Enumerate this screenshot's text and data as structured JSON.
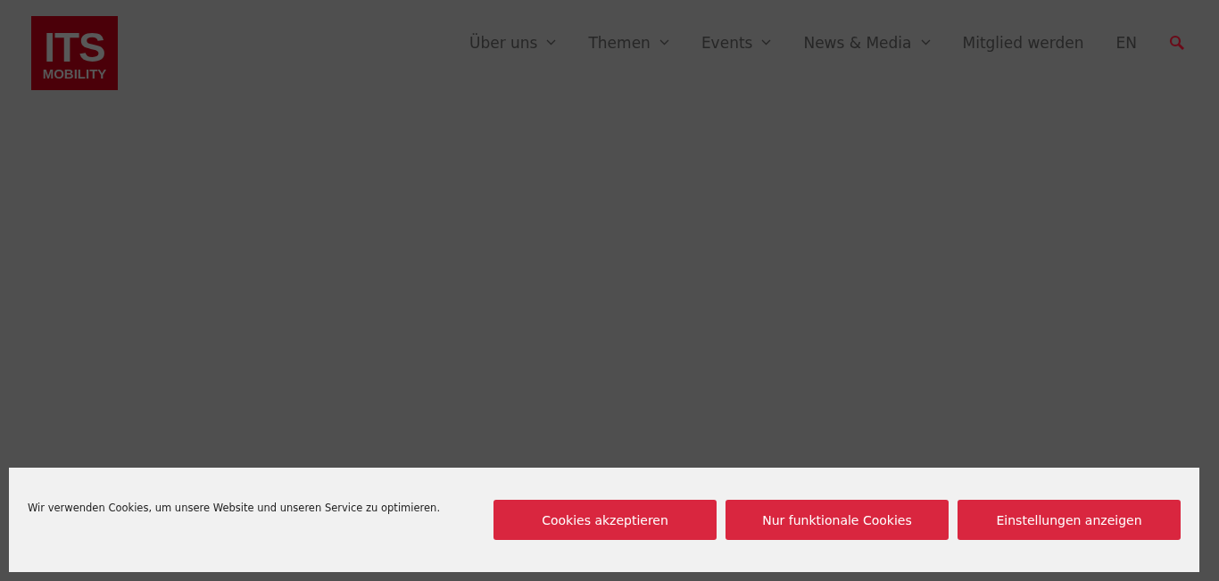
{
  "logo": {
    "line_1": "ITS",
    "line_2": "MOBILITY"
  },
  "nav": [
    {
      "label": "Über uns",
      "has_dropdown": true
    },
    {
      "label": "Themen",
      "has_dropdown": true
    },
    {
      "label": "Events",
      "has_dropdown": true
    },
    {
      "label": "News & Media",
      "has_dropdown": true
    },
    {
      "label": "Mitglied werden",
      "has_dropdown": false
    },
    {
      "label": "EN",
      "has_dropdown": false
    }
  ],
  "cookie_banner": {
    "message": "Wir verwenden Cookies, um unsere Website und unseren Service zu optimieren.",
    "buttons": [
      "Cookies akzeptieren",
      "Nur funktionale Cookies",
      "Einstellungen anzeigen"
    ]
  }
}
